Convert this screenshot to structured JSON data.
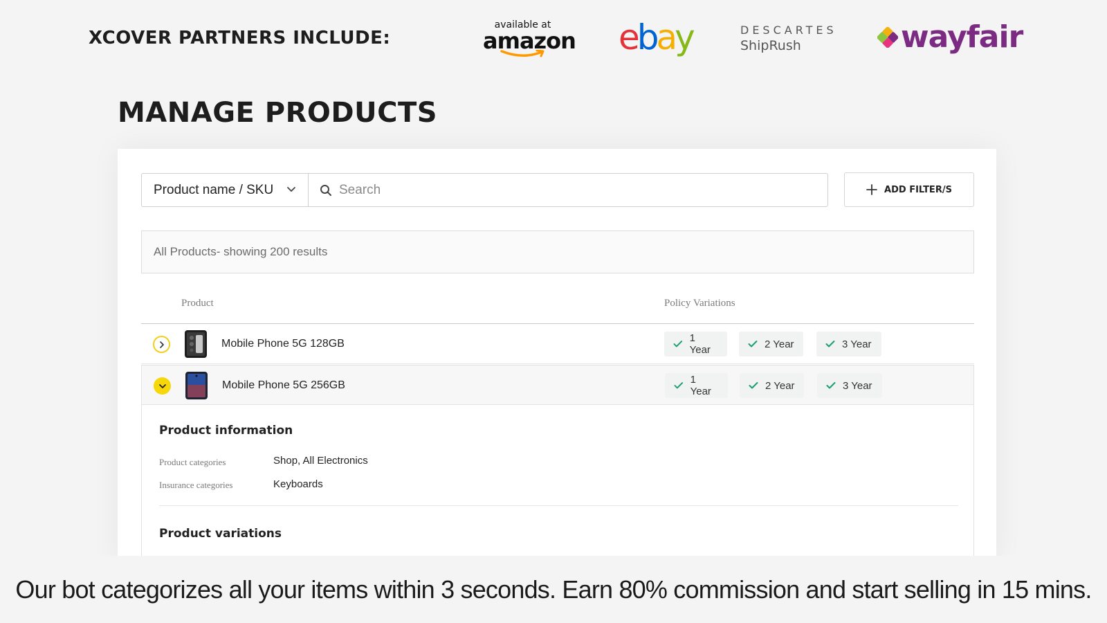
{
  "partners": {
    "title": "XCOVER PARTNERS INCLUDE:",
    "amazon": {
      "tagline": "available at",
      "name": "amazon",
      "icon": "amazon-logo"
    },
    "ebay": {
      "name": "ebay",
      "letters": [
        "e",
        "b",
        "a",
        "y"
      ],
      "colors": [
        "#e53238",
        "#0064d2",
        "#f5af02",
        "#86b817"
      ]
    },
    "descartes": {
      "line1": "DESCARTES",
      "line2": "ShipRush"
    },
    "wayfair": {
      "name": "wayfair",
      "icon": "wayfair-logo"
    }
  },
  "page": {
    "title": "MANAGE PRODUCTS"
  },
  "toolbar": {
    "filter_select": "Product name / SKU",
    "search_placeholder": "Search",
    "add_filter_label": "ADD FILTER/S"
  },
  "results": {
    "summary": "All Products- showing 200 results"
  },
  "table": {
    "columns": [
      "Product",
      "Policy Variations"
    ],
    "rows": [
      {
        "name": "Mobile Phone 5G 128GB",
        "expanded": false,
        "variations": [
          "1 Year",
          "2 Year",
          "3 Year"
        ]
      },
      {
        "name": "Mobile Phone 5G 256GB",
        "expanded": true,
        "variations": [
          "1 Year",
          "2 Year",
          "3 Year"
        ]
      }
    ]
  },
  "details": {
    "info_title": "Product information",
    "fields": [
      {
        "label": "Product categories",
        "value": "Shop, All Electronics"
      },
      {
        "label": "Insurance categories",
        "value": "Keyboards"
      }
    ],
    "variations_title": "Product variations"
  },
  "caption": "Our bot categorizes all your items within 3 seconds. Earn 80% commission and start selling in 15 mins.",
  "colors": {
    "accent_yellow": "#f6d80a",
    "check_green": "#1a9e6e",
    "wayfair_purple": "#7b2c82",
    "amazon_orange": "#ff9900"
  }
}
